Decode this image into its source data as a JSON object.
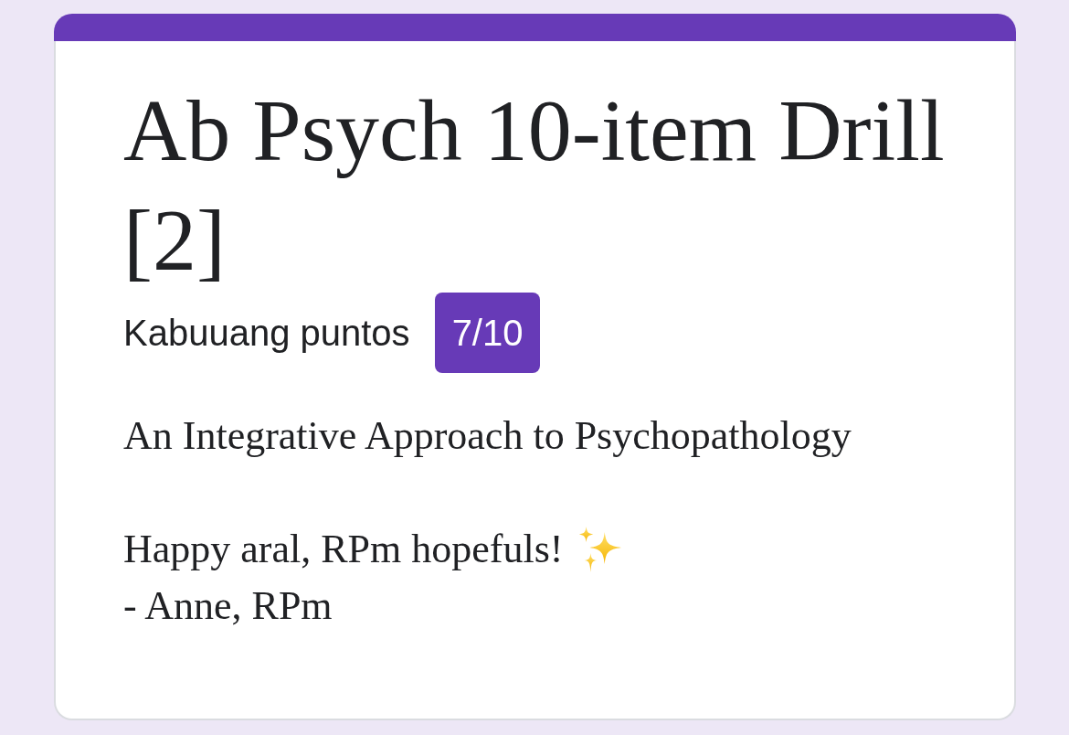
{
  "form": {
    "title": "Ab Psych 10-item Drill [2]"
  },
  "score": {
    "label": "Kabuuang puntos",
    "value": "7/10"
  },
  "description": [
    {
      "lines": [
        {
          "text": "An Integrative Approach to Psychopathology",
          "has_icon": false
        }
      ]
    },
    {
      "lines": [
        {
          "text": "Happy aral, RPm hopefuls!",
          "has_icon": true
        },
        {
          "text": "- Anne, RPm",
          "has_icon": false
        }
      ]
    }
  ]
}
